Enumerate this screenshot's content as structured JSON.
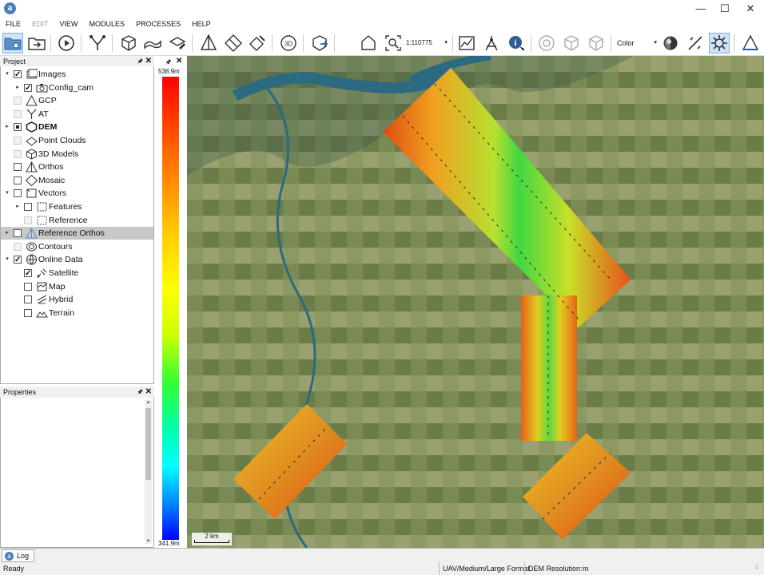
{
  "app": {
    "logo_glyph": "a"
  },
  "window_controls": {
    "minimize": "—",
    "maximize": "☐",
    "close": "✕"
  },
  "menu": [
    {
      "label": "FILE",
      "enabled": true
    },
    {
      "label": "EDIT",
      "enabled": false
    },
    {
      "label": "VIEW",
      "enabled": true
    },
    {
      "label": "MODULES",
      "enabled": true
    },
    {
      "label": "PROCESSES",
      "enabled": true
    },
    {
      "label": "HELP",
      "enabled": true
    }
  ],
  "toolbar": {
    "scale_value": "1:110775",
    "color_mode": "Color",
    "icons": [
      "open-project-icon",
      "import-icon",
      "play-icon",
      "tie-points-icon",
      "3d-box-icon",
      "surface-icon",
      "edit-surface-icon",
      "ortho-icon",
      "mosaic-icon",
      "paint-icon",
      "3d-view-icon",
      "export-icon",
      "home-icon",
      "zoom-extent-icon",
      "histogram-icon",
      "measure-icon",
      "info-icon",
      "target-icon",
      "cube-outline-icon",
      "cube-outline-icon-2",
      "shading-icon",
      "line-tool-icon",
      "sun-settings-icon",
      "triangle-icon"
    ]
  },
  "project_panel": {
    "title": "Project",
    "pin": "🖈",
    "close": "✕",
    "items": [
      {
        "label": "Images",
        "icon": "images-icon",
        "checked": "on",
        "expander": "▾",
        "level": 0,
        "bold": false
      },
      {
        "label": "Config_cam",
        "icon": "camera-icon",
        "checked": "on",
        "expander": "▸",
        "level": 1,
        "bold": false
      },
      {
        "label": "GCP",
        "icon": "gcp-icon",
        "checked": "disabled",
        "expander": "",
        "level": 0,
        "bold": false
      },
      {
        "label": "AT",
        "icon": "at-icon",
        "checked": "disabled",
        "expander": "",
        "level": 0,
        "bold": false
      },
      {
        "label": "DEM",
        "icon": "dem-icon",
        "checked": "partial",
        "expander": "▸",
        "level": 0,
        "bold": true
      },
      {
        "label": "Point Clouds",
        "icon": "point-clouds-icon",
        "checked": "disabled",
        "expander": "",
        "level": 0,
        "bold": false
      },
      {
        "label": "3D Models",
        "icon": "3d-models-icon",
        "checked": "disabled",
        "expander": "",
        "level": 0,
        "bold": false
      },
      {
        "label": "Orthos",
        "icon": "orthos-icon",
        "checked": "off",
        "expander": "",
        "level": 0,
        "bold": false
      },
      {
        "label": "Mosaic",
        "icon": "mosaic-icon",
        "checked": "off",
        "expander": "",
        "level": 0,
        "bold": false
      },
      {
        "label": "Vectors",
        "icon": "vectors-icon",
        "checked": "off",
        "expander": "▾",
        "level": 0,
        "bold": false
      },
      {
        "label": "Features",
        "icon": "features-icon",
        "checked": "off",
        "expander": "▸",
        "level": 1,
        "bold": false
      },
      {
        "label": "Reference",
        "icon": "reference-icon",
        "checked": "disabled",
        "expander": "",
        "level": 1,
        "bold": false
      },
      {
        "label": "Reference Orthos",
        "icon": "reference-orthos-icon",
        "checked": "off",
        "expander": "▸",
        "level": 0,
        "bold": false,
        "selected": true
      },
      {
        "label": "Contours",
        "icon": "contours-icon",
        "checked": "disabled",
        "expander": "",
        "level": 0,
        "bold": false
      },
      {
        "label": "Online Data",
        "icon": "online-data-icon",
        "checked": "on",
        "expander": "▾",
        "level": 0,
        "bold": false
      },
      {
        "label": "Satellite",
        "icon": "satellite-icon",
        "checked": "on",
        "expander": "",
        "level": 1,
        "bold": false
      },
      {
        "label": "Map",
        "icon": "map-icon",
        "checked": "off",
        "expander": "",
        "level": 1,
        "bold": false
      },
      {
        "label": "Hybrid",
        "icon": "hybrid-icon",
        "checked": "off",
        "expander": "",
        "level": 1,
        "bold": false
      },
      {
        "label": "Terrain",
        "icon": "terrain-icon",
        "checked": "off",
        "expander": "",
        "level": 1,
        "bold": false
      }
    ]
  },
  "properties_panel": {
    "title": "Properties",
    "pin": "🖈",
    "close": "✕"
  },
  "legend": {
    "max_label": "538.9m",
    "min_label": "341.9m",
    "pin": "🖈",
    "close": "✕"
  },
  "map": {
    "scale_bar_label": "2 km"
  },
  "log_tab": {
    "label": "Log",
    "icon_glyph": "a"
  },
  "status": {
    "ready": "Ready",
    "profile": "UAV/Medium/Large Format",
    "dem_resolution_label": "DEM Resolution:",
    "dem_unit": "m",
    "end_marker": "⁞⁞"
  }
}
